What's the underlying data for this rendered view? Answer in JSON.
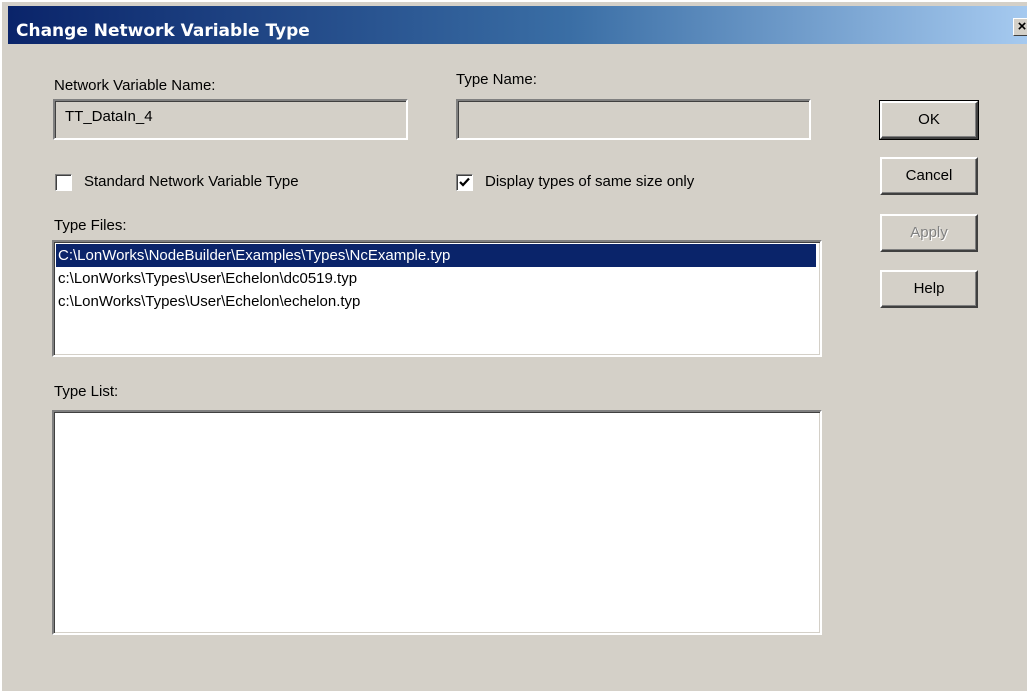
{
  "window": {
    "title": "Change Network Variable Type",
    "close_glyph": "×"
  },
  "form": {
    "nv_name_label": "Network Variable Name:",
    "nv_name_value": "TT_DataIn_4",
    "type_name_label": "Type Name:",
    "type_name_value": "",
    "standard_nv_type": {
      "label": "Standard Network Variable Type",
      "checked": false
    },
    "same_size_only": {
      "label": "Display types of same size only",
      "checked": true
    },
    "type_files_label": "Type Files:",
    "type_files": [
      {
        "path": "C:\\LonWorks\\NodeBuilder\\Examples\\Types\\NcExample.typ",
        "selected": true
      },
      {
        "path": "c:\\LonWorks\\Types\\User\\Echelon\\dc0519.typ",
        "selected": false
      },
      {
        "path": "c:\\LonWorks\\Types\\User\\Echelon\\echelon.typ",
        "selected": false
      }
    ],
    "type_list_label": "Type List:",
    "type_list": []
  },
  "buttons": {
    "ok": "OK",
    "cancel": "Cancel",
    "apply": "Apply",
    "help": "Help"
  },
  "colors": {
    "dialog_bg": "#d4d0c8",
    "title_start": "#0a246a",
    "title_end": "#a6caf0",
    "selection": "#0a246a"
  }
}
